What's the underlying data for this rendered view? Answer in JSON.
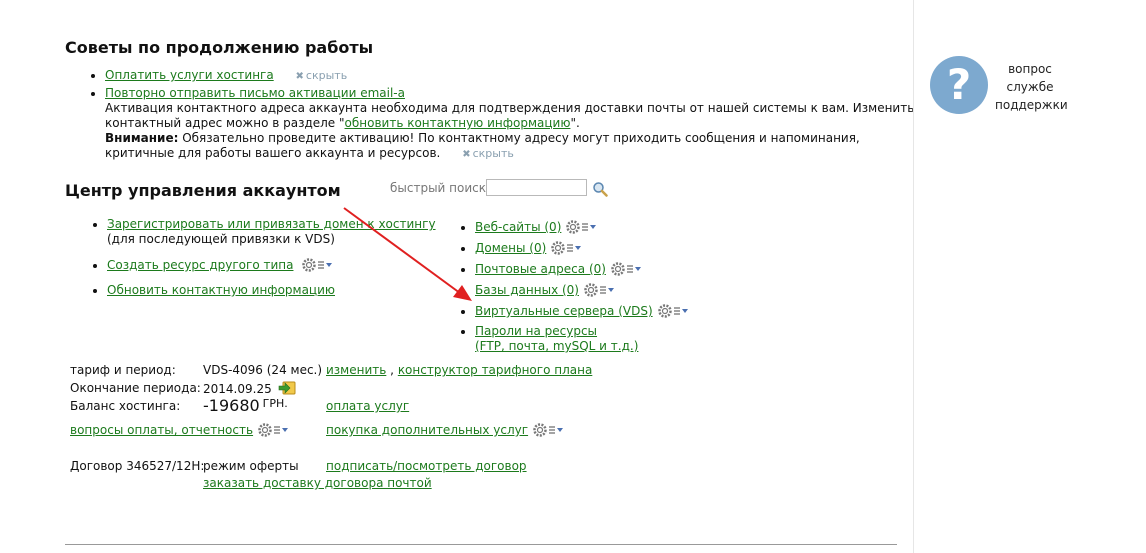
{
  "tips": {
    "title": "Советы по продолжению работы",
    "hide_label": "скрыть",
    "item1_link": "Оплатить услуги хостинга",
    "item2_link": "Повторно отправить письмо активации email-а",
    "item2_text_1": "Активация контактного адреса аккаунта необходима для подтверждения доставки почты от нашей системы к вам. Изменить контактный адрес можно в разделе \"",
    "item2_text_link": "обновить контактную информацию",
    "item2_text_2": "\".",
    "attention_label": "Внимание:",
    "attention_text": " Обязательно проведите активацию! По контактному адресу могут приходить сообщения и напоминания, критичные для работы вашего аккаунта и ресурсов."
  },
  "center": {
    "title": "Центр управления аккаунтом",
    "quick_search_label": "быстрый поиск:",
    "quick_search_value": ""
  },
  "left_list": {
    "register_link": "Зарегистрировать или привязать домен к хостингу",
    "register_note": "(для последующей привязки к VDS)",
    "create_link": "Создать ресурс другого типа",
    "update_link": "Обновить контактную информацию"
  },
  "right_list": {
    "websites": "Веб-сайты (0)",
    "domains": "Домены (0)",
    "mail": "Почтовые адреса (0)",
    "databases": "Базы данных (0)",
    "vds": "Виртуальные сервера (VDS)",
    "passwords_1": "Пароли на ресурсы",
    "passwords_2": "(FTP, почта, mySQL и т.д.)"
  },
  "info": {
    "tariff_label": "тариф и период:",
    "tariff_value": "VDS-4096 (24 мес.)",
    "change_link": "изменить",
    "comma": ",",
    "constructor_link": "конструктор тарифного плана",
    "end_label": "Окончание периода:",
    "end_value": "2014.09.25",
    "balance_label": "Баланс хостинга:",
    "balance_value": "-19680",
    "balance_currency": "ГРН.",
    "pay_link": "оплата услуг",
    "payment_questions_link": "вопросы оплаты, отчетность",
    "buy_extra_link": "покупка дополнительных услуг",
    "contract_label": "Договор 346527/12Н:",
    "contract_mode": "режим оферты",
    "sign_link": "подписать/посмотреть договор",
    "delivery_link": "заказать доставку договора почтой"
  },
  "support": {
    "question_mark": "?",
    "line1": "вопрос",
    "line2": "службе",
    "line3": "поддержки"
  },
  "colors": {
    "link": "#1c7a1c",
    "arrow": "#e02020",
    "help_circle": "#7da9cf"
  }
}
